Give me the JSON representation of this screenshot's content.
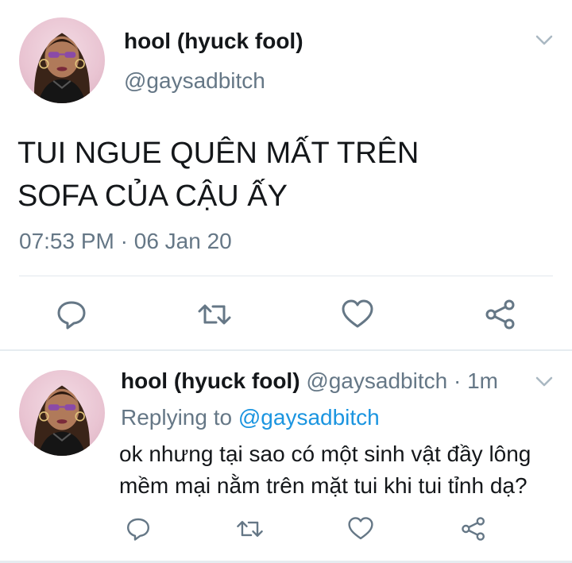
{
  "tweet": {
    "author": {
      "name": "hool (hyuck fool)",
      "handle": "@gaysadbitch"
    },
    "text_line1": "TUI NGUE QUÊN MẤT TRÊN",
    "text_line2": "SOFA CỦA CẬU ẤY",
    "time": "07:53 PM",
    "separator": " · ",
    "date": "06 Jan 20"
  },
  "reply": {
    "author": {
      "name": "hool (hyuck fool)",
      "handle": "@gaysadbitch"
    },
    "separator": " · ",
    "time_ago": "1m",
    "replying_prefix": "Replying to ",
    "replying_to": "@gaysadbitch",
    "text_line1": "ok nhưng tại sao có một sinh vật đầy lông",
    "text_line2": "mềm mại nằm trên mặt tui khi tui tỉnh dạ?"
  },
  "icons": {
    "reply": "reply-icon",
    "retweet": "retweet-icon",
    "like": "heart-icon",
    "share": "share-icon",
    "menu": "chevron-down-icon"
  },
  "colors": {
    "primary_text": "#14171a",
    "secondary_text": "#657786",
    "link": "#1b95e0",
    "icon": "#657786"
  }
}
